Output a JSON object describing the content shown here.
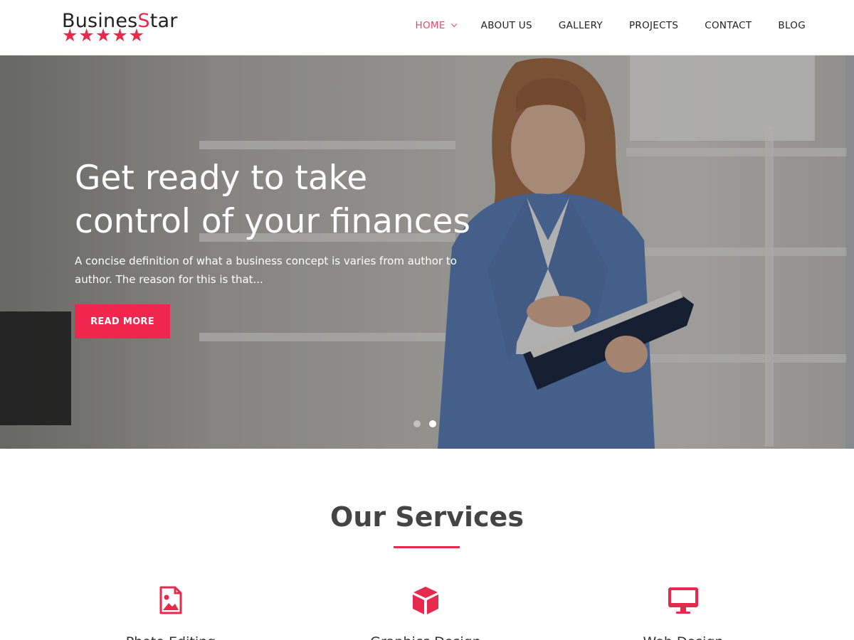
{
  "header": {
    "logo_main": "Busines",
    "logo_accent": "S",
    "logo_rest": "tar",
    "logo_stars": "★★★★★",
    "nav": [
      {
        "label": "HOME",
        "active": true
      },
      {
        "label": "ABOUT US",
        "active": false
      },
      {
        "label": "GALLERY",
        "active": false
      },
      {
        "label": "PROJECTS",
        "active": false
      },
      {
        "label": "CONTACT",
        "active": false
      },
      {
        "label": "BLOG",
        "active": false
      }
    ]
  },
  "hero": {
    "title_line1": "Get ready to take",
    "title_line2": "control of your finances",
    "description": "A concise definition of what a business concept is varies from author to author. The reason for this is that...",
    "button_label": "READ MORE",
    "slides_total": 2,
    "slide_active": 2
  },
  "services": {
    "title": "Our Services",
    "items": [
      {
        "name": "Photo Editing",
        "icon": "image-file-icon"
      },
      {
        "name": "Graphics Design",
        "icon": "cube-icon"
      },
      {
        "name": "Web Design",
        "icon": "monitor-icon"
      }
    ]
  },
  "colors": {
    "accent": "#e8294e",
    "nav_active": "#e8466a",
    "button": "#f0264f"
  }
}
